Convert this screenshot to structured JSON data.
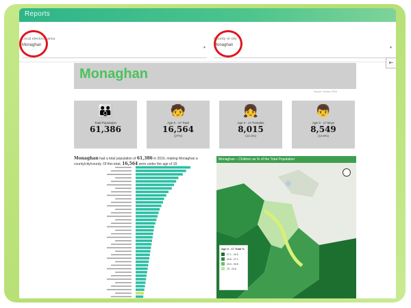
{
  "window": {
    "title": "Reports"
  },
  "filters": [
    {
      "label": "Local electoral area",
      "value": "Monaghan"
    },
    {
      "label": "County or city",
      "value": "Monaghan"
    }
  ],
  "report": {
    "title": "Monaghan",
    "note": "Source: Census 2016",
    "cards": [
      {
        "icon": "family-icon",
        "label": "Total Population",
        "value": "61,386",
        "pct": ""
      },
      {
        "icon": "child-icon",
        "label": "Age 0 - 17 Total",
        "value": "16,564",
        "pct": "(27%)"
      },
      {
        "icon": "girl-icon",
        "label": "Age 0 - 17 Females",
        "value": "8,015",
        "pct": "(13.1%)"
      },
      {
        "icon": "boy-icon",
        "label": "Age 0 - 17 Boys",
        "value": "8,549",
        "pct": "(13.9%)"
      }
    ],
    "description": {
      "place": "Monaghan",
      "text1": " had a total population of ",
      "pop": "61,386",
      "text2": " in 2016, making Monaghan a county/city/county. Of this total, ",
      "kids": "16,564",
      "text3": " were under the age of 18."
    },
    "map": {
      "title": "Monaghan – Children as % of the Total Population",
      "legend_title": "Age 0 - 17 Total %",
      "legend_items": [
        "27.1 - 29.5",
        "25.8 - 27.1",
        "24.6 - 25.8",
        "23 - 24.6"
      ]
    }
  },
  "chart_data": {
    "type": "bar",
    "orientation": "horizontal",
    "values": [
      100,
      92,
      86,
      78,
      74,
      70,
      66,
      60,
      56,
      52,
      50,
      47,
      44,
      42,
      40,
      38,
      36,
      34,
      33,
      32,
      31,
      30,
      29,
      28,
      27,
      26,
      25,
      24,
      23,
      22,
      21,
      20,
      19,
      18,
      17,
      16,
      15,
      14
    ],
    "highlight_index": 36,
    "colors": {
      "bar": "#2bbfa4",
      "highlight": "#c8e06a"
    }
  },
  "colors": {
    "accent": "#4cc25b",
    "titlebar": "#2fb58a",
    "annotation": "#e0141b"
  }
}
